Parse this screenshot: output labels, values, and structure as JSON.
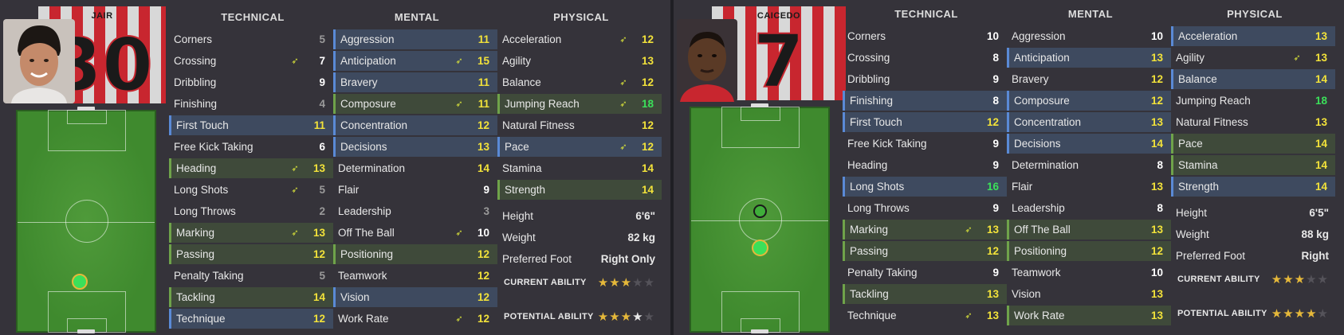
{
  "colors": {
    "yellow": "#f2e23a",
    "white": "#ffffff",
    "grey": "#9a9a9a",
    "green": "#3be05a"
  },
  "headers": {
    "technical": "TECHNICAL",
    "mental": "MENTAL",
    "physical": "PHYSICAL"
  },
  "players": [
    {
      "kit_name": "JAIR",
      "kit_number": "30",
      "technical": [
        {
          "label": "Corners",
          "value": "5",
          "color": "grey",
          "hl": ""
        },
        {
          "label": "Crossing",
          "value": "7",
          "color": "white",
          "hl": "",
          "arrow": true
        },
        {
          "label": "Dribbling",
          "value": "9",
          "color": "white",
          "hl": ""
        },
        {
          "label": "Finishing",
          "value": "4",
          "color": "grey",
          "hl": ""
        },
        {
          "label": "First Touch",
          "value": "11",
          "color": "yellow",
          "hl": "blue"
        },
        {
          "label": "Free Kick Taking",
          "value": "6",
          "color": "white",
          "hl": ""
        },
        {
          "label": "Heading",
          "value": "13",
          "color": "yellow",
          "hl": "green",
          "arrow": true
        },
        {
          "label": "Long Shots",
          "value": "5",
          "color": "grey",
          "hl": "",
          "arrow": true
        },
        {
          "label": "Long Throws",
          "value": "2",
          "color": "grey",
          "hl": ""
        },
        {
          "label": "Marking",
          "value": "13",
          "color": "yellow",
          "hl": "green",
          "arrow": true
        },
        {
          "label": "Passing",
          "value": "12",
          "color": "yellow",
          "hl": "green"
        },
        {
          "label": "Penalty Taking",
          "value": "5",
          "color": "grey",
          "hl": ""
        },
        {
          "label": "Tackling",
          "value": "14",
          "color": "yellow",
          "hl": "green"
        },
        {
          "label": "Technique",
          "value": "12",
          "color": "yellow",
          "hl": "blue"
        }
      ],
      "mental": [
        {
          "label": "Aggression",
          "value": "11",
          "color": "yellow",
          "hl": "blue"
        },
        {
          "label": "Anticipation",
          "value": "15",
          "color": "yellow",
          "hl": "blue",
          "arrow": true
        },
        {
          "label": "Bravery",
          "value": "11",
          "color": "yellow",
          "hl": "blue"
        },
        {
          "label": "Composure",
          "value": "11",
          "color": "yellow",
          "hl": "green",
          "arrow": true
        },
        {
          "label": "Concentration",
          "value": "12",
          "color": "yellow",
          "hl": "blue"
        },
        {
          "label": "Decisions",
          "value": "13",
          "color": "yellow",
          "hl": "blue"
        },
        {
          "label": "Determination",
          "value": "14",
          "color": "yellow",
          "hl": ""
        },
        {
          "label": "Flair",
          "value": "9",
          "color": "white",
          "hl": ""
        },
        {
          "label": "Leadership",
          "value": "3",
          "color": "grey",
          "hl": ""
        },
        {
          "label": "Off The Ball",
          "value": "10",
          "color": "white",
          "hl": "",
          "arrow": true
        },
        {
          "label": "Positioning",
          "value": "12",
          "color": "yellow",
          "hl": "green"
        },
        {
          "label": "Teamwork",
          "value": "12",
          "color": "yellow",
          "hl": ""
        },
        {
          "label": "Vision",
          "value": "12",
          "color": "yellow",
          "hl": "blue"
        },
        {
          "label": "Work Rate",
          "value": "12",
          "color": "yellow",
          "hl": "",
          "arrow": true
        }
      ],
      "physical": [
        {
          "label": "Acceleration",
          "value": "12",
          "color": "yellow",
          "hl": "",
          "arrow": true
        },
        {
          "label": "Agility",
          "value": "13",
          "color": "yellow",
          "hl": ""
        },
        {
          "label": "Balance",
          "value": "12",
          "color": "yellow",
          "hl": "",
          "arrow": true
        },
        {
          "label": "Jumping Reach",
          "value": "18",
          "color": "green",
          "hl": "green",
          "arrow": true
        },
        {
          "label": "Natural Fitness",
          "value": "12",
          "color": "yellow",
          "hl": ""
        },
        {
          "label": "Pace",
          "value": "12",
          "color": "yellow",
          "hl": "blue",
          "arrow": true
        },
        {
          "label": "Stamina",
          "value": "14",
          "color": "yellow",
          "hl": ""
        },
        {
          "label": "Strength",
          "value": "14",
          "color": "yellow",
          "hl": "green"
        }
      ],
      "info": [
        {
          "label": "Height",
          "value": "6'6\""
        },
        {
          "label": "Weight",
          "value": "82 kg"
        },
        {
          "label": "Preferred Foot",
          "value": "Right Only"
        }
      ],
      "current_ability": {
        "label": "CURRENT ABILITY",
        "stars": 2.5,
        "max": 5
      },
      "potential_ability": {
        "label": "POTENTIAL ABILITY",
        "stars": 3.5,
        "max": 5
      },
      "position_markers": [
        "DC"
      ]
    },
    {
      "kit_name": "CAICEDO",
      "kit_number": "7",
      "technical": [
        {
          "label": "Corners",
          "value": "10",
          "color": "white",
          "hl": ""
        },
        {
          "label": "Crossing",
          "value": "8",
          "color": "white",
          "hl": ""
        },
        {
          "label": "Dribbling",
          "value": "9",
          "color": "white",
          "hl": ""
        },
        {
          "label": "Finishing",
          "value": "8",
          "color": "white",
          "hl": "blue"
        },
        {
          "label": "First Touch",
          "value": "12",
          "color": "yellow",
          "hl": "blue"
        },
        {
          "label": "Free Kick Taking",
          "value": "9",
          "color": "white",
          "hl": ""
        },
        {
          "label": "Heading",
          "value": "9",
          "color": "white",
          "hl": ""
        },
        {
          "label": "Long Shots",
          "value": "16",
          "color": "green",
          "hl": "blue"
        },
        {
          "label": "Long Throws",
          "value": "9",
          "color": "white",
          "hl": ""
        },
        {
          "label": "Marking",
          "value": "13",
          "color": "yellow",
          "hl": "green",
          "arrow": true
        },
        {
          "label": "Passing",
          "value": "12",
          "color": "yellow",
          "hl": "green"
        },
        {
          "label": "Penalty Taking",
          "value": "9",
          "color": "white",
          "hl": ""
        },
        {
          "label": "Tackling",
          "value": "13",
          "color": "yellow",
          "hl": "green"
        },
        {
          "label": "Technique",
          "value": "13",
          "color": "yellow",
          "hl": "",
          "arrow": true
        }
      ],
      "mental": [
        {
          "label": "Aggression",
          "value": "10",
          "color": "white",
          "hl": ""
        },
        {
          "label": "Anticipation",
          "value": "13",
          "color": "yellow",
          "hl": "blue"
        },
        {
          "label": "Bravery",
          "value": "12",
          "color": "yellow",
          "hl": ""
        },
        {
          "label": "Composure",
          "value": "12",
          "color": "yellow",
          "hl": "blue"
        },
        {
          "label": "Concentration",
          "value": "13",
          "color": "yellow",
          "hl": "blue"
        },
        {
          "label": "Decisions",
          "value": "14",
          "color": "yellow",
          "hl": "blue"
        },
        {
          "label": "Determination",
          "value": "8",
          "color": "white",
          "hl": ""
        },
        {
          "label": "Flair",
          "value": "13",
          "color": "yellow",
          "hl": ""
        },
        {
          "label": "Leadership",
          "value": "8",
          "color": "white",
          "hl": ""
        },
        {
          "label": "Off The Ball",
          "value": "13",
          "color": "yellow",
          "hl": "green"
        },
        {
          "label": "Positioning",
          "value": "12",
          "color": "yellow",
          "hl": "green"
        },
        {
          "label": "Teamwork",
          "value": "10",
          "color": "white",
          "hl": ""
        },
        {
          "label": "Vision",
          "value": "13",
          "color": "yellow",
          "hl": ""
        },
        {
          "label": "Work Rate",
          "value": "13",
          "color": "yellow",
          "hl": "green"
        }
      ],
      "physical": [
        {
          "label": "Acceleration",
          "value": "13",
          "color": "yellow",
          "hl": "blue"
        },
        {
          "label": "Agility",
          "value": "13",
          "color": "yellow",
          "hl": "",
          "arrow": true
        },
        {
          "label": "Balance",
          "value": "14",
          "color": "yellow",
          "hl": "blue"
        },
        {
          "label": "Jumping Reach",
          "value": "18",
          "color": "green",
          "hl": ""
        },
        {
          "label": "Natural Fitness",
          "value": "13",
          "color": "yellow",
          "hl": ""
        },
        {
          "label": "Pace",
          "value": "14",
          "color": "yellow",
          "hl": "green"
        },
        {
          "label": "Stamina",
          "value": "14",
          "color": "yellow",
          "hl": "green"
        },
        {
          "label": "Strength",
          "value": "14",
          "color": "yellow",
          "hl": "blue"
        }
      ],
      "info": [
        {
          "label": "Height",
          "value": "6'5\""
        },
        {
          "label": "Weight",
          "value": "88 kg"
        },
        {
          "label": "Preferred Foot",
          "value": "Right"
        }
      ],
      "current_ability": {
        "label": "CURRENT ABILITY",
        "stars": 3,
        "max": 5
      },
      "potential_ability": {
        "label": "POTENTIAL ABILITY",
        "stars": 4,
        "max": 5
      },
      "position_markers": [
        "DM",
        "MC"
      ]
    }
  ]
}
